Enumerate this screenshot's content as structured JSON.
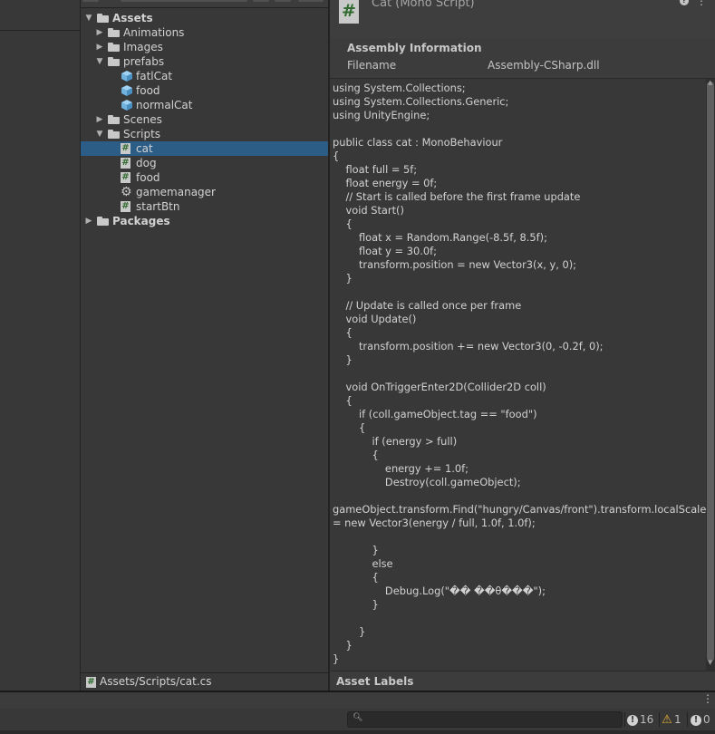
{
  "project": {
    "tree": [
      {
        "label": "Assets",
        "depth": 0,
        "type": "folder",
        "arrow": "▼",
        "bold": true
      },
      {
        "label": "Animations",
        "depth": 1,
        "type": "folder",
        "arrow": "▶"
      },
      {
        "label": "Images",
        "depth": 1,
        "type": "folder",
        "arrow": "▶"
      },
      {
        "label": "prefabs",
        "depth": 1,
        "type": "folder",
        "arrow": "▼"
      },
      {
        "label": "fatlCat",
        "depth": 2,
        "type": "prefab"
      },
      {
        "label": "food",
        "depth": 2,
        "type": "prefab"
      },
      {
        "label": "normalCat",
        "depth": 2,
        "type": "prefab"
      },
      {
        "label": "Scenes",
        "depth": 1,
        "type": "folder",
        "arrow": "▶"
      },
      {
        "label": "Scripts",
        "depth": 1,
        "type": "folder",
        "arrow": "▼"
      },
      {
        "label": "cat",
        "depth": 2,
        "type": "script",
        "selected": true
      },
      {
        "label": "dog",
        "depth": 2,
        "type": "script"
      },
      {
        "label": "food",
        "depth": 2,
        "type": "script"
      },
      {
        "label": "gamemanager",
        "depth": 2,
        "type": "gear"
      },
      {
        "label": "startBtn",
        "depth": 2,
        "type": "script"
      },
      {
        "label": "Packages",
        "depth": 0,
        "type": "folder",
        "arrow": "▶",
        "bold": true
      }
    ],
    "path": "Assets/Scripts/cat.cs"
  },
  "inspector": {
    "title": "Cat (Mono Script)",
    "assembly_title": "Assembly Information",
    "filename_label": "Filename",
    "filename_value": "Assembly-CSharp.dll",
    "code": "using System.Collections;\nusing System.Collections.Generic;\nusing UnityEngine;\n\npublic class cat : MonoBehaviour\n{\n    float full = 5f;\n    float energy = 0f;\n    // Start is called before the first frame update\n    void Start()\n    {\n        float x = Random.Range(-8.5f, 8.5f);\n        float y = 30.0f;\n        transform.position = new Vector3(x, y, 0);\n    }\n\n    // Update is called once per frame\n    void Update()\n    {\n        transform.position += new Vector3(0, -0.2f, 0);\n    }\n\n    void OnTriggerEnter2D(Collider2D coll)\n    {\n        if (coll.gameObject.tag == \"food\")\n        {\n            if (energy > full)\n            {\n                energy += 1.0f;\n                Destroy(coll.gameObject);\n\ngameObject.transform.Find(\"hungry/Canvas/front\").transform.localScale\n= new Vector3(energy / full, 1.0f, 1.0f);\n\n            }\n            else\n            {\n                Debug.Log(\"�� ��θ���\");\n            }\n\n        }\n    }\n}",
    "asset_labels": "Asset Labels"
  },
  "console": {
    "info_count": "16",
    "warn_count": "1",
    "error_count": "0",
    "search_placeholder": ""
  },
  "colors": {
    "background": "#383838",
    "selection": "#2c5d87",
    "warning": "#e6b42e",
    "script_icon": "#2f6a2f",
    "prefab_icon": "#6fb2e0"
  },
  "icons": {
    "folder": "folder-icon",
    "prefab": "prefab-cube-icon",
    "script": "csharp-script-icon",
    "gear": "gear-icon"
  }
}
